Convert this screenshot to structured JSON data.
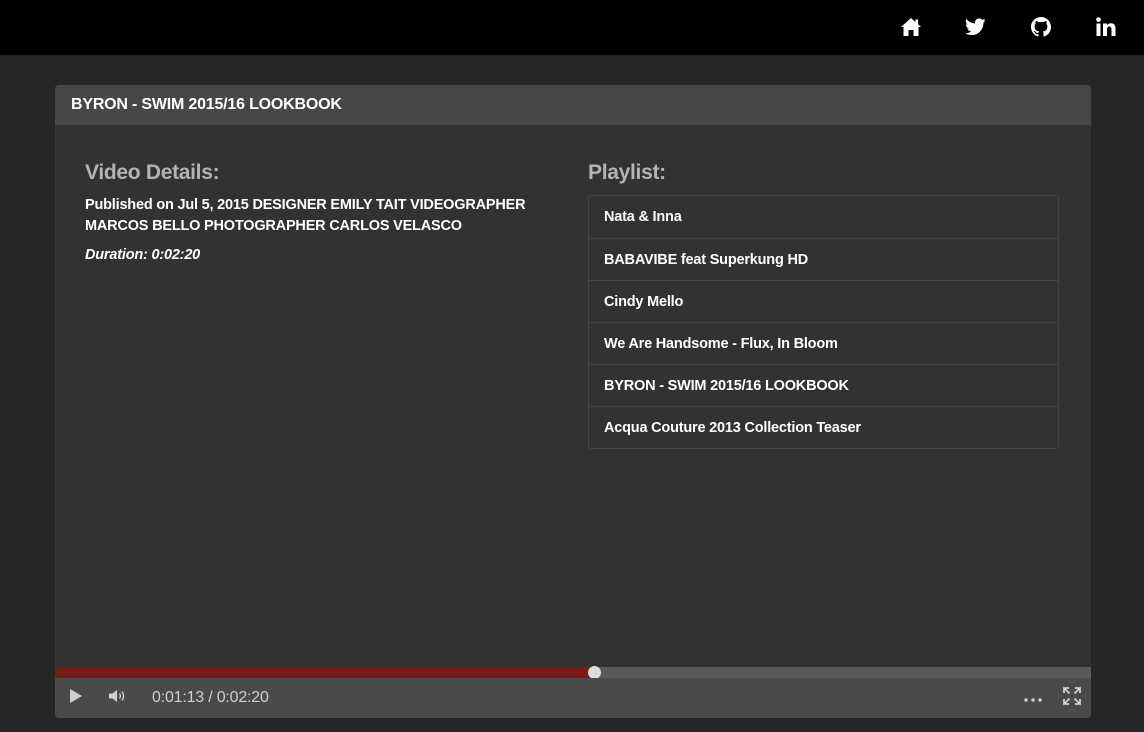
{
  "nav": {
    "icons": [
      "home-icon",
      "twitter-icon",
      "github-icon",
      "linkedin-icon"
    ]
  },
  "panel": {
    "title": "BYRON - SWIM 2015/16 LOOKBOOK"
  },
  "details": {
    "heading": "Video Details:",
    "description": "Published on Jul 5, 2015 DESIGNER EMILY TAIT VIDEOGRAPHER MARCOS BELLO PHOTOGRAPHER CARLOS VELASCO",
    "duration": "Duration: 0:02:20"
  },
  "playlist": {
    "heading": "Playlist:",
    "items": [
      "Nata & Inna",
      "BABAVIBE feat Superkung HD",
      "Cindy Mello",
      "We Are Handsome - Flux, In Bloom",
      "BYRON - SWIM 2015/16 LOOKBOOK",
      "Acqua Couture 2013 Collection Teaser"
    ]
  },
  "player": {
    "time": "0:01:13 / 0:02:20",
    "progress_fraction": 0.52,
    "played_color": "#7a1a16",
    "icons": [
      "play-icon",
      "volume-icon",
      "more-icon",
      "fullscreen-icon"
    ]
  }
}
